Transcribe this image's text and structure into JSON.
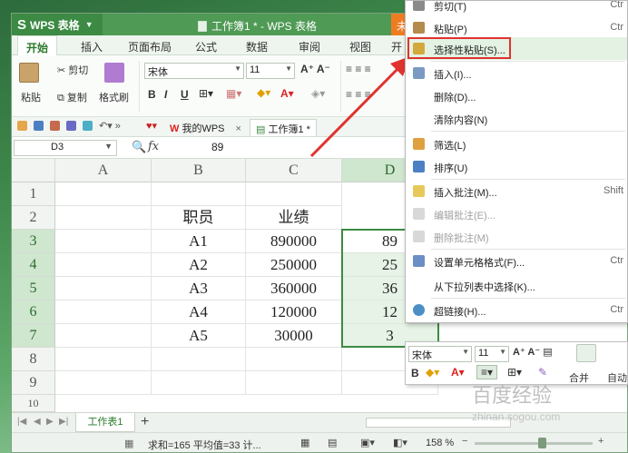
{
  "app": {
    "logo_text": "WPS 表格",
    "doc_title": "工作簿1 * - WPS 表格",
    "title_tab_partial": "未"
  },
  "menu_tabs": [
    "开始",
    "插入",
    "页面布局",
    "公式",
    "数据",
    "审阅",
    "视图",
    "开"
  ],
  "ribbon": {
    "paste": "粘贴",
    "cut": "剪切",
    "copy": "复制",
    "format_painter": "格式刷",
    "font_name": "宋体",
    "font_size": "11"
  },
  "doc_tabs": {
    "home": "我的WPS",
    "workbook": "工作簿1 *"
  },
  "formula_bar": {
    "name_box": "D3",
    "fx": "fx",
    "value": "89"
  },
  "columns": [
    "A",
    "B",
    "C",
    "D"
  ],
  "rows": [
    "1",
    "2",
    "3",
    "4",
    "5",
    "6",
    "7",
    "8",
    "9",
    "10"
  ],
  "table": {
    "header": [
      "职员",
      "业绩"
    ],
    "data": [
      [
        "A1",
        "890000",
        "89"
      ],
      [
        "A2",
        "250000",
        "25"
      ],
      [
        "A3",
        "360000",
        "36"
      ],
      [
        "A4",
        "120000",
        "12"
      ],
      [
        "A5",
        "30000",
        "3"
      ]
    ]
  },
  "sheet_tab": "工作表1",
  "status": {
    "sum_avg": "求和=165  平均值=33  计...",
    "zoom": "158 %"
  },
  "context_menu": {
    "cut": {
      "label": "剪切(T)",
      "shortcut": "Ctr"
    },
    "paste": {
      "label": "粘贴(P)",
      "shortcut": "Ctr"
    },
    "paste_special": {
      "label": "选择性粘贴(S)..."
    },
    "insert": {
      "label": "插入(I)..."
    },
    "delete": {
      "label": "删除(D)..."
    },
    "clear": {
      "label": "清除内容(N)"
    },
    "filter": {
      "label": "筛选(L)"
    },
    "sort": {
      "label": "排序(U)"
    },
    "insert_comment": {
      "label": "插入批注(M)...",
      "shortcut": "Shift"
    },
    "edit_comment": {
      "label": "编辑批注(E)..."
    },
    "delete_comment": {
      "label": "删除批注(M)"
    },
    "format_cells": {
      "label": "设置单元格格式(F)...",
      "shortcut": "Ctr"
    },
    "pick_list": {
      "label": "从下拉列表中选择(K)..."
    },
    "hyperlink": {
      "label": "超链接(H)...",
      "shortcut": "Ctr"
    }
  },
  "mini_toolbar": {
    "font": "宋体",
    "size": "11",
    "merge": "合并",
    "auto": "自动"
  },
  "watermark": {
    "main": "百度经验",
    "sub": "zhinan.sogou.com"
  },
  "colors": {
    "brand_green": "#4f9a55",
    "highlight_red": "#e0332e",
    "orange_tab": "#f07c22"
  }
}
